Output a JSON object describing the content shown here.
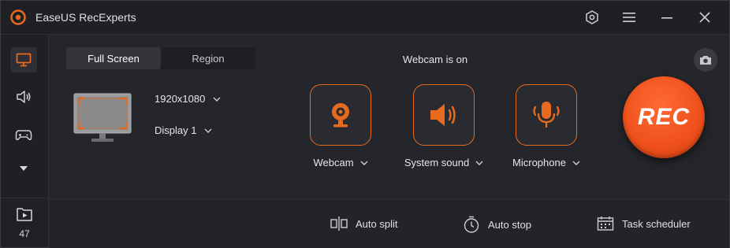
{
  "app": {
    "title": "EaseUS RecExperts"
  },
  "sidebar": {
    "recordings_count": "47"
  },
  "mode": {
    "tabs": [
      "Full Screen",
      "Region"
    ],
    "active": "Full Screen"
  },
  "screen": {
    "resolution": "1920x1080",
    "display": "Display 1"
  },
  "webcam_status": "Webcam is on",
  "sources": {
    "webcam": "Webcam",
    "system_sound": "System sound",
    "microphone": "Microphone"
  },
  "rec_label": "REC",
  "tools": {
    "auto_split": "Auto split",
    "auto_stop": "Auto stop",
    "task_scheduler": "Task scheduler"
  },
  "colors": {
    "accent": "#f0521d",
    "accent_border": "#e86a1e",
    "background": "#25262b"
  }
}
